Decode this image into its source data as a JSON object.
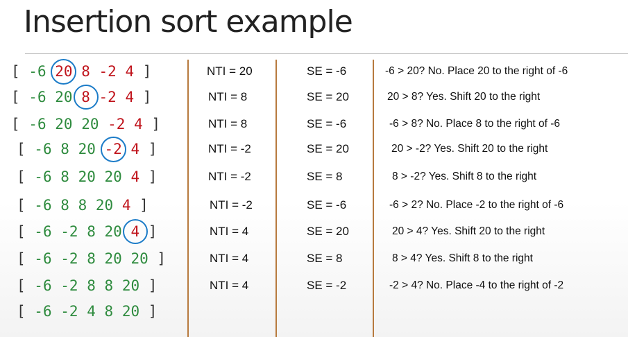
{
  "title": "Insertion sort example",
  "rows": [
    {
      "tokens": [
        {
          "t": "-6",
          "c": "g"
        },
        {
          "t": "20",
          "c": "r",
          "circle": true
        },
        {
          "t": "8",
          "c": "r"
        },
        {
          "t": "-2",
          "c": "r"
        },
        {
          "t": "4",
          "c": "r"
        }
      ],
      "nti": "NTI = 20",
      "se": "SE = -6",
      "exp": "-6 > 20? No. Place 20 to the right of -6"
    },
    {
      "tokens": [
        {
          "t": "-6",
          "c": "g"
        },
        {
          "t": "20",
          "c": "g"
        },
        {
          "t": "8",
          "c": "r",
          "circle": true
        },
        {
          "t": "-2",
          "c": "r"
        },
        {
          "t": "4",
          "c": "r"
        }
      ],
      "nti": "NTI = 8",
      "se": "SE = 20",
      "exp": "20 > 8? Yes. Shift 20 to the right"
    },
    {
      "tokens": [
        {
          "t": "-6",
          "c": "g"
        },
        {
          "t": "20",
          "c": "g"
        },
        {
          "t": "20",
          "c": "g"
        },
        {
          "t": "-2",
          "c": "r"
        },
        {
          "t": "4",
          "c": "r"
        }
      ],
      "nti": "NTI = 8",
      "se": "SE = -6",
      "exp": "-6 > 8? No. Place 8 to the right of -6"
    },
    {
      "tokens": [
        {
          "t": "-6",
          "c": "g"
        },
        {
          "t": "8",
          "c": "g"
        },
        {
          "t": "20",
          "c": "g"
        },
        {
          "t": "-2",
          "c": "r",
          "circle": true
        },
        {
          "t": "4",
          "c": "r"
        }
      ],
      "nti": "NTI = -2",
      "se": "SE = 20",
      "exp": "20 > -2? Yes. Shift 20 to the right"
    },
    {
      "tokens": [
        {
          "t": "-6",
          "c": "g"
        },
        {
          "t": "8",
          "c": "g"
        },
        {
          "t": "20",
          "c": "g"
        },
        {
          "t": "20",
          "c": "g"
        },
        {
          "t": "4",
          "c": "r"
        }
      ],
      "nti": "NTI = -2",
      "se": "SE = 8",
      "exp": "8 > -2? Yes. Shift 8 to the right"
    },
    {
      "tokens": [
        {
          "t": "-6",
          "c": "g"
        },
        {
          "t": "8",
          "c": "g"
        },
        {
          "t": "8",
          "c": "g"
        },
        {
          "t": "20",
          "c": "g"
        },
        {
          "t": "4",
          "c": "r"
        }
      ],
      "nti": "NTI = -2",
      "se": "SE = -6",
      "exp": "-6 > 2? No. Place -2 to the right of -6"
    },
    {
      "tokens": [
        {
          "t": "-6",
          "c": "g"
        },
        {
          "t": "-2",
          "c": "g"
        },
        {
          "t": "8",
          "c": "g"
        },
        {
          "t": "20",
          "c": "g"
        },
        {
          "t": "4",
          "c": "r",
          "circle": true
        }
      ],
      "nti": "NTI = 4",
      "se": "SE = 20",
      "exp": "20 > 4? Yes. Shift 20 to the right"
    },
    {
      "tokens": [
        {
          "t": "-6",
          "c": "g"
        },
        {
          "t": "-2",
          "c": "g"
        },
        {
          "t": "8",
          "c": "g"
        },
        {
          "t": "20",
          "c": "g"
        },
        {
          "t": "20",
          "c": "g"
        }
      ],
      "nti": "NTI = 4",
      "se": "SE = 8",
      "exp": "8 > 4? Yes. Shift 8 to the right"
    },
    {
      "tokens": [
        {
          "t": "-6",
          "c": "g"
        },
        {
          "t": "-2",
          "c": "g"
        },
        {
          "t": "8",
          "c": "g"
        },
        {
          "t": "8",
          "c": "g"
        },
        {
          "t": "20",
          "c": "g"
        }
      ],
      "nti": "NTI = 4",
      "se": "SE = -2",
      "exp": "-2 > 4? No. Place -4 to the right of -2"
    },
    {
      "tokens": [
        {
          "t": "-6",
          "c": "g"
        },
        {
          "t": "-2",
          "c": "g"
        },
        {
          "t": "4",
          "c": "g"
        },
        {
          "t": "8",
          "c": "g"
        },
        {
          "t": "20",
          "c": "g"
        }
      ],
      "nti": "",
      "se": "",
      "exp": ""
    }
  ],
  "colors": {
    "sorted": "#2e8b3e",
    "unsorted": "#c0141c",
    "circle": "#1c7cc8",
    "divider": "#b77a3e"
  }
}
